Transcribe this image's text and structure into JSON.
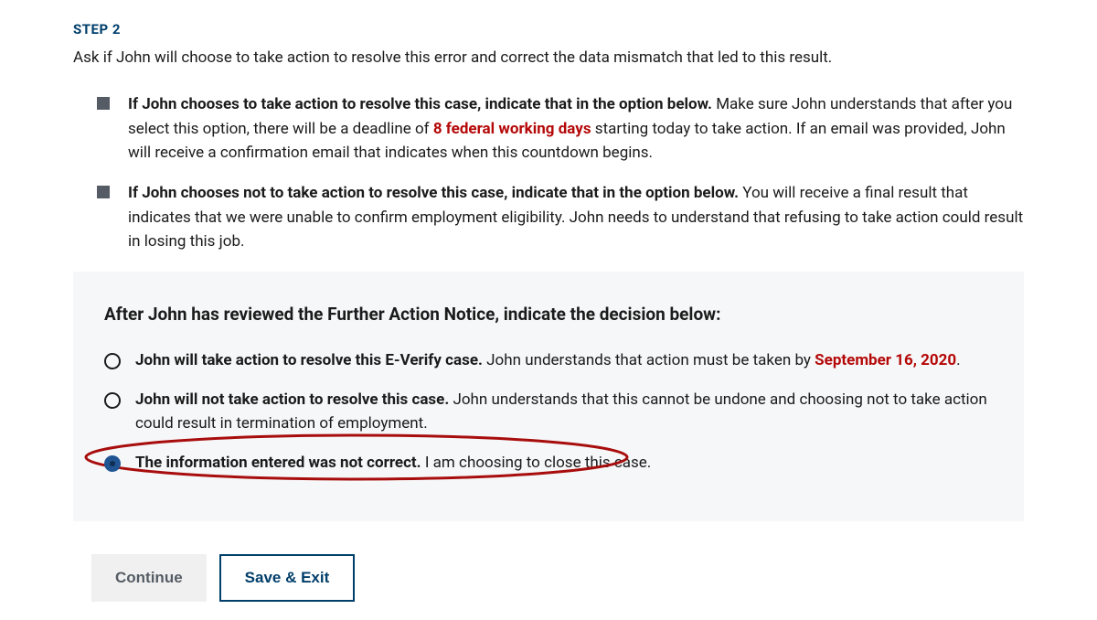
{
  "step_label": "STEP 2",
  "step_desc": "Ask if John will choose to take action to resolve this error and correct the data mismatch that led to this result.",
  "bullets": [
    {
      "bold": "If John chooses to take action to resolve this case, indicate that in the option below.",
      "pre_highlight": " Make sure John understands that after you select this option, there will be a deadline of ",
      "highlight": "8 federal working days",
      "post_highlight": " starting today to take action. If an email was provided, John will receive a confirmation email that indicates when this countdown begins."
    },
    {
      "bold": "If John chooses not to take action to resolve this case, indicate that in the option below.",
      "pre_highlight": " You will receive a final result that indicates that we were unable to confirm employment eligibility. John needs to understand that refusing to take action could result in losing this job.",
      "highlight": "",
      "post_highlight": ""
    }
  ],
  "decision_heading": "After John has reviewed the Further Action Notice, indicate the decision below:",
  "options": [
    {
      "bold": "John will take action to resolve this E-Verify case.",
      "pre_highlight": " John understands that action must be taken by ",
      "highlight": "September 16, 2020",
      "post_highlight": ".",
      "selected": false
    },
    {
      "bold": "John will not take action to resolve this case.",
      "pre_highlight": " John understands that this cannot be undone and choosing not to take action could result in termination of employment.",
      "highlight": "",
      "post_highlight": "",
      "selected": false
    },
    {
      "bold": "The information entered was not correct.",
      "pre_highlight": " I am choosing to close this case.",
      "highlight": "",
      "post_highlight": "",
      "selected": true
    }
  ],
  "buttons": {
    "continue": "Continue",
    "save_exit": "Save & Exit"
  },
  "colors": {
    "accent": "#003e6b",
    "error": "#b50909",
    "selected_radio": "#205493",
    "annotation": "#a80d0d"
  }
}
